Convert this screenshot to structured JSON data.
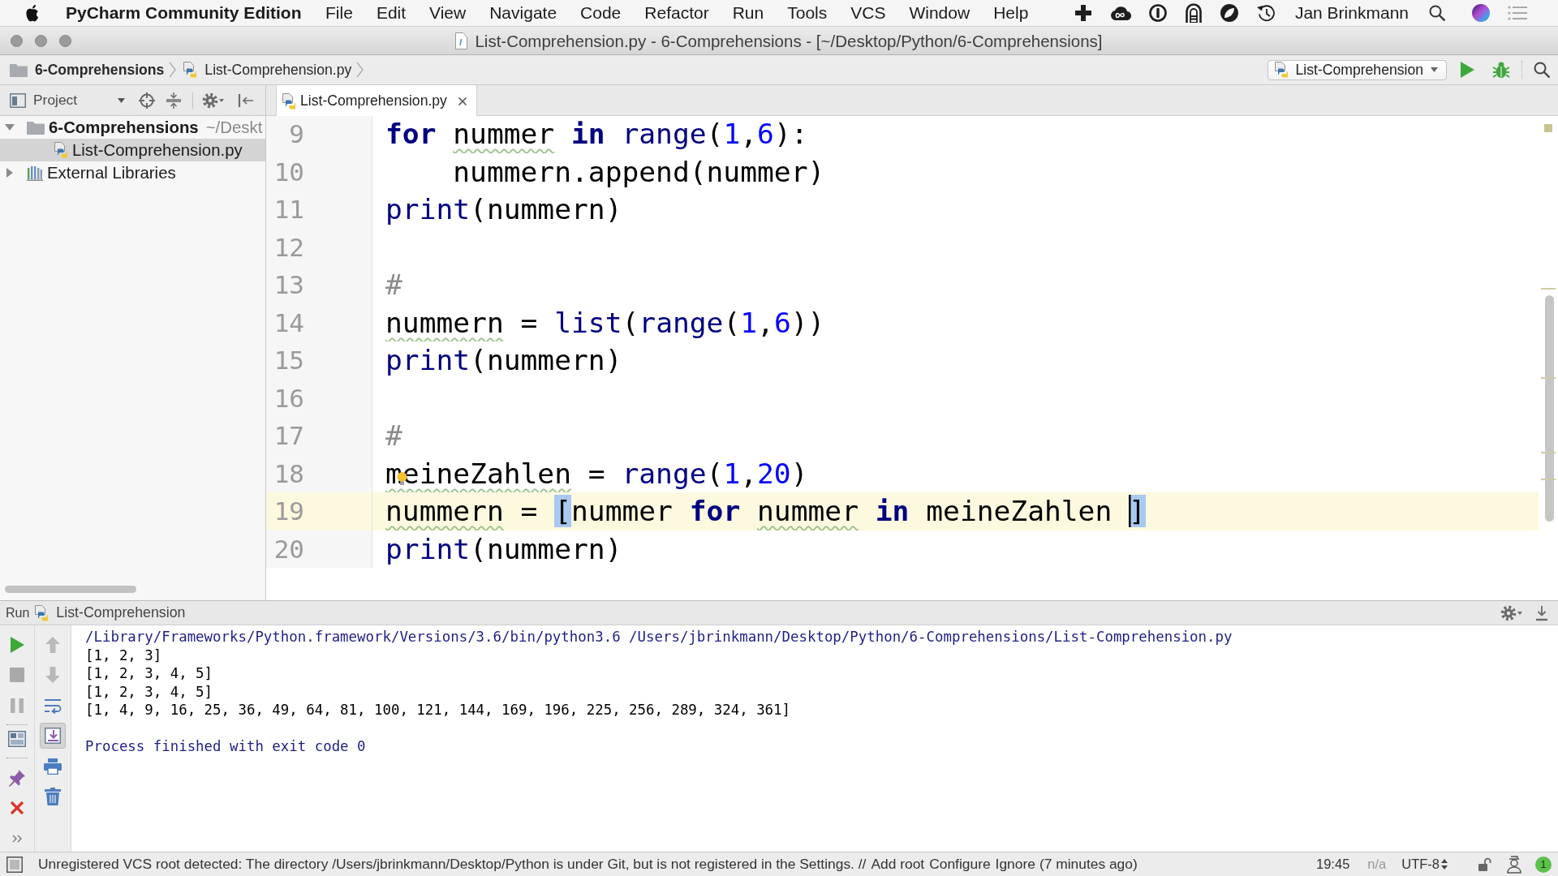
{
  "menu_bar": {
    "app_name": "PyCharm Community Edition",
    "items": [
      "File",
      "Edit",
      "View",
      "Navigate",
      "Code",
      "Refactor",
      "Run",
      "Tools",
      "VCS",
      "Window",
      "Help"
    ],
    "user": "Jan Brinkmann"
  },
  "window": {
    "title": "List-Comprehension.py - 6-Comprehensions - [~/Desktop/Python/6-Comprehensions]"
  },
  "navigation_bar": {
    "breadcrumbs": [
      {
        "label": "6-Comprehensions",
        "kind": "folder"
      },
      {
        "label": "List-Comprehension.py",
        "kind": "file"
      }
    ],
    "run_configuration": "List-Comprehension"
  },
  "project_panel": {
    "title": "Project",
    "tree": [
      {
        "label": "6-Comprehensions",
        "path": "~/Deskt",
        "kind": "folder",
        "expanded": true,
        "selected": false,
        "children": [
          {
            "label": "List-Comprehension.py",
            "kind": "file",
            "selected": true
          }
        ]
      },
      {
        "label": "External Libraries",
        "kind": "library",
        "expanded": false,
        "selected": false
      }
    ]
  },
  "editor": {
    "tabs": [
      {
        "label": "List-Comprehension.py",
        "selected": true
      }
    ],
    "lines": [
      {
        "number": "9",
        "current": false,
        "bulb": false,
        "tokens": [
          {
            "text": "for ",
            "kind": "keyword"
          },
          {
            "text": "nummer",
            "kind": "typo"
          },
          {
            "text": " in ",
            "kind": "keyword"
          },
          {
            "text": "range",
            "kind": "builtin"
          },
          {
            "text": "(",
            "kind": "plain"
          },
          {
            "text": "1",
            "kind": "number"
          },
          {
            "text": ",",
            "kind": "plain"
          },
          {
            "text": "6",
            "kind": "number"
          },
          {
            "text": "):",
            "kind": "plain"
          }
        ]
      },
      {
        "number": "10",
        "current": false,
        "bulb": false,
        "tokens": [
          {
            "text": "    nummern.append(nummer)",
            "kind": "plain"
          }
        ]
      },
      {
        "number": "11",
        "current": false,
        "bulb": false,
        "tokens": [
          {
            "text": "print",
            "kind": "builtin"
          },
          {
            "text": "(nummern)",
            "kind": "plain"
          }
        ]
      },
      {
        "number": "12",
        "current": false,
        "bulb": false
      },
      {
        "number": "13",
        "current": false,
        "bulb": false,
        "tokens": [
          {
            "text": "#",
            "kind": "comment"
          }
        ]
      },
      {
        "number": "14",
        "current": false,
        "bulb": false,
        "tokens": [
          {
            "text": "nummern",
            "kind": "typo"
          },
          {
            "text": " = ",
            "kind": "plain"
          },
          {
            "text": "list",
            "kind": "builtin"
          },
          {
            "text": "(",
            "kind": "plain"
          },
          {
            "text": "range",
            "kind": "builtin"
          },
          {
            "text": "(",
            "kind": "plain"
          },
          {
            "text": "1",
            "kind": "number"
          },
          {
            "text": ",",
            "kind": "plain"
          },
          {
            "text": "6",
            "kind": "number"
          },
          {
            "text": "))",
            "kind": "plain"
          }
        ]
      },
      {
        "number": "15",
        "current": false,
        "bulb": false,
        "tokens": [
          {
            "text": "print",
            "kind": "builtin"
          },
          {
            "text": "(nummern)",
            "kind": "plain"
          }
        ]
      },
      {
        "number": "16",
        "current": false,
        "bulb": false
      },
      {
        "number": "17",
        "current": false,
        "bulb": false,
        "tokens": [
          {
            "text": "#",
            "kind": "comment"
          }
        ]
      },
      {
        "number": "18",
        "current": false,
        "bulb": true,
        "tokens": [
          {
            "text": "meineZahlen",
            "kind": "typo"
          },
          {
            "text": " = ",
            "kind": "plain"
          },
          {
            "text": "range",
            "kind": "builtin"
          },
          {
            "text": "(",
            "kind": "plain"
          },
          {
            "text": "1",
            "kind": "number"
          },
          {
            "text": ",",
            "kind": "plain"
          },
          {
            "text": "20",
            "kind": "number"
          },
          {
            "text": ")",
            "kind": "plain"
          }
        ]
      },
      {
        "number": "19",
        "current": true,
        "bulb": false,
        "tokens": [
          {
            "text": "nummern",
            "kind": "typo"
          },
          {
            "text": " = ",
            "kind": "plain"
          },
          {
            "text": "[",
            "kind": "brace"
          },
          {
            "text": "nummer ",
            "kind": "plain"
          },
          {
            "text": "for ",
            "kind": "keyword"
          },
          {
            "text": "nummer",
            "kind": "typo"
          },
          {
            "text": " in ",
            "kind": "keyword"
          },
          {
            "text": "meineZahlen ",
            "kind": "plain"
          },
          {
            "text": "]",
            "kind": "brace-caret"
          }
        ]
      },
      {
        "number": "20",
        "current": false,
        "bulb": false,
        "tokens": [
          {
            "text": "print",
            "kind": "builtin"
          },
          {
            "text": "(nummern)",
            "kind": "plain"
          }
        ]
      }
    ]
  },
  "run_panel": {
    "title": "Run",
    "tab": "List-Comprehension",
    "scroll_to_end": true,
    "output": [
      {
        "text": "/Library/Frameworks/Python.framework/Versions/3.6/bin/python3.6 /Users/jbrinkmann/Desktop/Python/6-Comprehensions/List-Comprehension.py",
        "kind": "command"
      },
      {
        "text": "[1, 2, 3]",
        "kind": "stdout"
      },
      {
        "text": "[1, 2, 3, 4, 5]",
        "kind": "stdout"
      },
      {
        "text": "[1, 2, 3, 4, 5]",
        "kind": "stdout"
      },
      {
        "text": "[1, 4, 9, 16, 25, 36, 49, 64, 81, 100, 121, 144, 169, 196, 225, 256, 289, 324, 361]",
        "kind": "stdout"
      },
      {
        "text": "Process finished with exit code 0",
        "kind": "exit"
      }
    ]
  },
  "status_bar": {
    "message": "Unregistered VCS root detected: The directory /Users/jbrinkmann/Desktop/Python is under Git, but is not registered in the Settings. //",
    "actions": [
      "Add root",
      "Configure",
      "Ignore"
    ],
    "age": "(7 minutes ago)",
    "caret_position": "19:45",
    "line_separator": "n/a",
    "encoding": "UTF-8",
    "notifications": "1"
  }
}
